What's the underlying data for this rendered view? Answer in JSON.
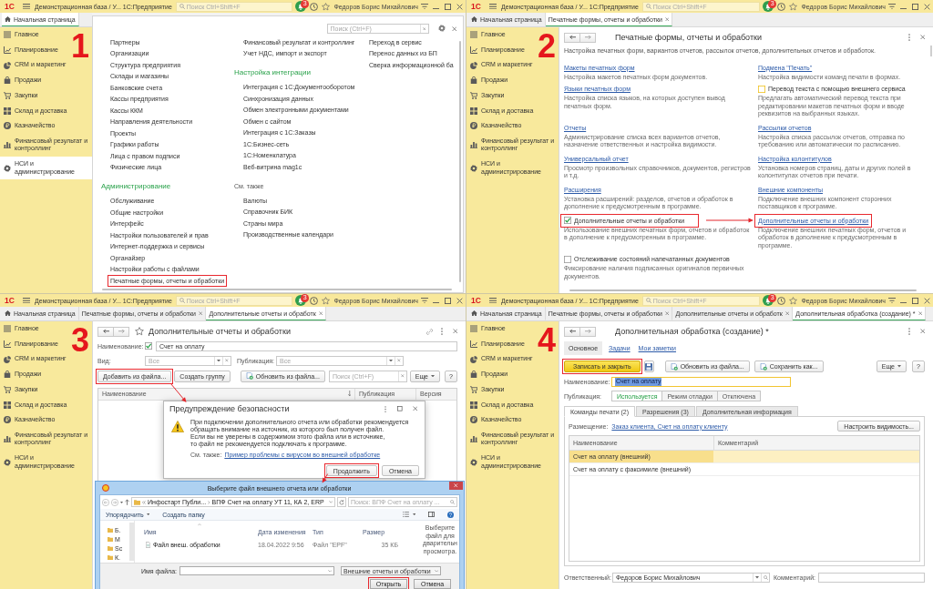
{
  "panels": [
    {
      "kind": "start",
      "step": "1",
      "title_bar": {
        "logo": "1С",
        "title": "Демонстрационная база / У... 1С:Предприятие",
        "search_placeholder": "Поиск Ctrl+Shift+F",
        "badge": "3",
        "user": "Федоров Борис Михайлович"
      },
      "tabs": [
        {
          "kind": "home",
          "label": "Начальная страница",
          "selected": true
        }
      ],
      "sidebar": [
        {
          "label": "Главное",
          "selected": false
        },
        {
          "label": "Планирование",
          "selected": false
        },
        {
          "label": "CRM и маркетинг",
          "selected": false
        },
        {
          "label": "Продажи",
          "selected": false
        },
        {
          "label": "Закупки",
          "selected": false
        },
        {
          "label": "Склад и доставка",
          "selected": false
        },
        {
          "label": "Казначейство",
          "selected": false
        },
        {
          "label": "Финансовый результат и контроллинг",
          "selected": false
        },
        {
          "label": "НСИ и администрирование",
          "selected": true
        }
      ],
      "search": {
        "placeholder": "Поиск (Ctrl+F)"
      },
      "columns": [
        {
          "groups": [
            {
              "items": [
                {
                  "label": "Партнеры"
                },
                {
                  "label": "Организации"
                },
                {
                  "label": "Структура предприятия"
                },
                {
                  "label": "Склады и магазины"
                },
                {
                  "label": "Банковские счета"
                },
                {
                  "label": "Кассы предприятия"
                },
                {
                  "label": "Кассы ККМ"
                },
                {
                  "label": "Направления деятельности"
                },
                {
                  "label": "Проекты"
                },
                {
                  "label": "Графики работы"
                },
                {
                  "label": "Лица с правом подписи"
                },
                {
                  "label": "Физические лица"
                }
              ]
            },
            {
              "heading": {
                "kind": "section",
                "text": "Администрирование"
              },
              "items": [
                {
                  "label": "Обслуживание",
                  "highlighted": false
                },
                {
                  "label": "Общие настройки",
                  "highlighted": false
                },
                {
                  "label": "Интерфейс",
                  "highlighted": false
                },
                {
                  "label": "Настройки пользователей и прав",
                  "highlighted": false
                },
                {
                  "label": "Интернет-поддержка и сервисы",
                  "highlighted": false
                },
                {
                  "label": "Органайзер",
                  "highlighted": false
                },
                {
                  "label": "Настройки работы с файлами",
                  "highlighted": false
                },
                {
                  "label": "Печатные формы, отчеты и обработки",
                  "highlighted": true
                }
              ]
            }
          ]
        },
        {
          "groups": [
            {
              "items": [
                {
                  "label": "Финансовый результат и контроллинг"
                },
                {
                  "label": "Учет НДС, импорт и экспорт"
                }
              ]
            },
            {
              "heading": {
                "kind": "section",
                "text": "Настройка интеграции"
              },
              "items": [
                {
                  "label": "Интеграция с 1С:Документооборотом"
                },
                {
                  "label": "Синхронизация данных"
                },
                {
                  "label": "Обмен электронными документами"
                },
                {
                  "label": "Обмен с сайтом"
                },
                {
                  "label": "Интеграция с 1С:Заказы"
                },
                {
                  "label": "1С:Бизнес-сеть"
                },
                {
                  "label": "1С:Номенклатура"
                },
                {
                  "label": "Веб-витрина mag1c"
                }
              ]
            },
            {
              "heading": {
                "kind": "see_also",
                "text": "См. также"
              },
              "items": [
                {
                  "label": "Валюты"
                },
                {
                  "label": "Справочник БИК"
                },
                {
                  "label": "Страны мира"
                },
                {
                  "label": "Производственные календари"
                }
              ]
            }
          ]
        },
        {
          "groups": [
            {
              "items": [
                {
                  "label": "Переход в сервис"
                },
                {
                  "label": "Перенос данных из БП"
                },
                {
                  "label": "Сверка информационной ба"
                }
              ]
            }
          ]
        }
      ]
    },
    {
      "kind": "print_forms",
      "step": "2",
      "title_bar": {
        "logo": "1С",
        "title": "Демонстрационная база / У... 1С:Предприятие",
        "search_placeholder": "Поиск Ctrl+Shift+F",
        "badge": "3",
        "user": "Федоров Борис Михайлович"
      },
      "tabs": [
        {
          "kind": "home",
          "label": "Начальная страница",
          "selected": false
        },
        {
          "kind": "page",
          "label": "Печатные формы, отчеты и обработки",
          "selected": true
        }
      ],
      "sidebar": [
        {
          "label": "Главное",
          "selected": false
        },
        {
          "label": "Планирование",
          "selected": false
        },
        {
          "label": "CRM и маркетинг",
          "selected": false
        },
        {
          "label": "Продажи",
          "selected": false
        },
        {
          "label": "Закупки",
          "selected": false
        },
        {
          "label": "Склад и доставка",
          "selected": false
        },
        {
          "label": "Казначейство",
          "selected": false
        },
        {
          "label": "Финансовый результат и контроллинг",
          "selected": false
        },
        {
          "label": "НСИ и администрирование",
          "selected": false
        }
      ],
      "title": "Печатные формы, отчеты и обработки",
      "description": "Настройка печатных форм, вариантов отчетов, рассылок отчетов, дополнительных отчетов и обработок.",
      "rows": [
        {
          "left": [
            {
              "kind": "link",
              "label": "Макеты печатных форм",
              "description": "Настройка макетов печатных форм документов.",
              "highlighted": false
            },
            {
              "kind": "link",
              "label": "Языки печатных форм",
              "description": "Настройка списка языков, на которых доступен вывод печатных форм.",
              "highlighted": false
            }
          ],
          "right": [
            {
              "kind": "link",
              "label": "Подмена \"Печать\"",
              "description": "Настройка видимости команд печати в формах.",
              "highlighted": false
            },
            {
              "kind": "checkbox",
              "label": "Перевод текста с помощью внешнего сервиса",
              "checked": false,
              "focused": true,
              "description": "Предлагать автоматический перевод текста при редактировании макетов печатных форм и вводе реквизитов на выбранных языках.",
              "highlighted": false
            }
          ]
        },
        {
          "left": [
            {
              "kind": "link",
              "label": "Отчеты",
              "description": "Администрирование списка всех вариантов отчетов, назначение ответственных и настройка видимости.",
              "highlighted": false
            }
          ],
          "right": [
            {
              "kind": "link",
              "label": "Рассылки отчетов",
              "description": "Настройка списка рассылок отчетов, отправка по требованию или автоматически по расписанию.",
              "highlighted": false
            }
          ]
        },
        {
          "left": [
            {
              "kind": "link",
              "label": "Универсальный отчет",
              "description": "Просмотр произвольных справочников, документов, регистров и т.д.",
              "highlighted": false
            }
          ],
          "right": [
            {
              "kind": "link",
              "label": "Настройка колонтитулов",
              "description": "Установка номеров страниц, даты и других полей в колонтитулах отчетов при печати.",
              "highlighted": false
            }
          ]
        },
        {
          "left": [
            {
              "kind": "link",
              "label": "Расширения",
              "description": "Установка расширений: разделов, отчетов и обработок в дополнение к предусмотренным в программе.",
              "highlighted": false
            }
          ],
          "right": [
            {
              "kind": "link",
              "label": "Внешние компоненты",
              "description": "Подключение внешних компонент сторонних поставщиков к программе.",
              "highlighted": false
            }
          ]
        },
        {
          "left": [
            {
              "kind": "checkbox",
              "label": "Дополнительные отчеты и обработки",
              "checked": true,
              "focused": false,
              "description": "Использование внешних печатных форм, отчетов и обработок в дополнение к предусмотренным в программе.",
              "highlighted": true
            }
          ],
          "right": [
            {
              "kind": "link",
              "label": "Дополнительные отчеты и обработки",
              "description": "Подключение внешних печатных форм, отчетов и обработок в дополнение к предусмотренным в программе.",
              "highlighted": true
            }
          ]
        },
        {
          "left": [
            {
              "kind": "checkbox",
              "label": "Отслеживание состояний напечатанных документов",
              "checked": false,
              "focused": false,
              "description": "Фиксирование наличия подписанных оригиналов первичных документов.",
              "highlighted": false
            }
          ]
        }
      ]
    },
    {
      "kind": "reports_list",
      "step": "3",
      "title_bar": {
        "logo": "1С",
        "title": "Демонстрационная база / У... 1С:Предприятие",
        "search_placeholder": "Поиск Ctrl+Shift+F",
        "badge": "3",
        "user": "Федоров Борис Михайлович"
      },
      "tabs": [
        {
          "kind": "home",
          "label": "Начальная страница",
          "selected": false
        },
        {
          "kind": "page",
          "label": "Печатные формы, отчеты и обработки",
          "selected": false
        },
        {
          "kind": "page",
          "label": "Дополнительные отчеты и обработк",
          "selected": true
        }
      ],
      "sidebar": [
        {
          "label": "Главное",
          "selected": false
        },
        {
          "label": "Планирование",
          "selected": false
        },
        {
          "label": "CRM и маркетинг",
          "selected": false
        },
        {
          "label": "Продажи",
          "selected": false
        },
        {
          "label": "Закупки",
          "selected": false
        },
        {
          "label": "Склад и доставка",
          "selected": false
        },
        {
          "label": "Казначейство",
          "selected": false
        },
        {
          "label": "Финансовый результат и контроллинг",
          "selected": false
        },
        {
          "label": "НСИ и администрирование",
          "selected": false
        }
      ],
      "title": "Дополнительные отчеты и обработки",
      "name_filter": {
        "label": "Наименование:",
        "checked": true,
        "value": "Счет на оплату"
      },
      "kind_filter": {
        "label": "Вид:",
        "placeholder": "Все"
      },
      "publication_filter": {
        "label": "Публикация:",
        "placeholder": "Все"
      },
      "toolbar": [
        {
          "kind": "button",
          "label": "Добавить из файла...",
          "highlighted": true
        },
        {
          "kind": "button",
          "label": "Создать группу",
          "highlighted": false
        },
        {
          "kind": "icon_button",
          "label": "Обновить из файла...",
          "highlighted": false
        }
      ],
      "search": {
        "placeholder": "Поиск (Ctrl+F)"
      },
      "more": "Еще",
      "help": "?",
      "table": {
        "columns": [
          {
            "label": "Наименование",
            "sorted": true
          },
          {
            "label": "Публикация",
            "sorted": false
          },
          {
            "label": "Версия",
            "sorted": false
          }
        ]
      },
      "security_dialog": {
        "title": "Предупреждение безопасности",
        "message": "При подключении дополнительного отчета или обработки рекомендуется\nобращать внимание на источник, из которого был получен файл.\nЕсли вы не уверены в содержимом этого файла или в источнике,\nто файл не рекомендуется подключать к программе.",
        "see_also_label": "См. также:",
        "see_also_link": "Пример проблемы с вирусом во внешней обработке",
        "buttons": [
          {
            "label": "Продолжить",
            "highlighted": true
          },
          {
            "label": "Отмена",
            "highlighted": false
          }
        ]
      },
      "file_dialog": {
        "title": "Выберите файл внешнего отчета или обработки",
        "path": [
          "Инфостарт Публи...",
          "ВПФ Счет на оплату УТ 11, КА 2, ERP"
        ],
        "search_placeholder": "Поиск: ВПФ Счет на оплату ...",
        "toolbar": [
          {
            "kind": "menu",
            "label": "Упорядочить"
          },
          {
            "kind": "button",
            "label": "Создать папку"
          }
        ],
        "nav": [
          "Б.",
          "М",
          "Sc",
          "К."
        ],
        "columns": [
          "Имя",
          "Дата изменения",
          "Тип",
          "Размер"
        ],
        "files": [
          {
            "name": "Файл внеш. обработки",
            "modified": "18.04.2022 9:56",
            "type": "Файл \"EPF\"",
            "size": "35 КБ"
          }
        ],
        "preview_text": "Выберите\nфайл для\nдварительн\nпросмотра.",
        "file_name_label": "Имя файла:",
        "filter": "Внешние отчеты и обработки",
        "buttons": [
          {
            "label": "Открыть",
            "highlighted": true
          },
          {
            "label": "Отмена",
            "highlighted": false
          }
        ]
      }
    },
    {
      "kind": "processing_form",
      "step": "4",
      "title_bar": {
        "logo": "1С",
        "title": "Демонстрационная база / У... 1С:Предприятие",
        "search_placeholder": "Поиск Ctrl+Shift+F",
        "badge": "3",
        "user": "Федоров Борис Михайлович"
      },
      "tabs": [
        {
          "kind": "home",
          "label": "Начальная страница",
          "selected": false
        },
        {
          "kind": "page",
          "label": "Печатные формы, отчеты и обработки",
          "selected": false
        },
        {
          "kind": "page",
          "label": "Дополнительные отчеты и обработк",
          "selected": false
        },
        {
          "kind": "page",
          "label": "Дополнительная обработка (создание) *",
          "selected": true
        }
      ],
      "sidebar": [
        {
          "label": "Главное",
          "selected": false
        },
        {
          "label": "Планирование",
          "selected": false
        },
        {
          "label": "CRM и маркетинг",
          "selected": false
        },
        {
          "label": "Продажи",
          "selected": false
        },
        {
          "label": "Закупки",
          "selected": false
        },
        {
          "label": "Склад и доставка",
          "selected": false
        },
        {
          "label": "Казначейство",
          "selected": false
        },
        {
          "label": "Финансовый результат и контроллинг",
          "selected": false
        },
        {
          "label": "НСИ и администрирование",
          "selected": false
        }
      ],
      "title": "Дополнительная обработка (создание) *",
      "form_tabs": [
        {
          "label": "Основное",
          "selected": true
        },
        {
          "label": "Задачи",
          "selected": false
        },
        {
          "label": "Мои заметки",
          "selected": false
        }
      ],
      "toolbar": [
        {
          "kind": "primary",
          "label": "Записать и закрыть",
          "highlighted": true
        },
        {
          "kind": "icon",
          "highlighted": false
        },
        {
          "kind": "icon_button",
          "label": "Обновить из файла...",
          "highlighted": false
        },
        {
          "kind": "icon_button",
          "label": "Сохранить как...",
          "highlighted": false
        }
      ],
      "more": "Еще",
      "help": "?",
      "name_field": {
        "label": "Наименование:",
        "value": "Счет на оплату",
        "focused": true
      },
      "publication": {
        "label": "Публикация:",
        "options": [
          {
            "label": "Используется",
            "selected": true
          },
          {
            "label": "Режим отладки",
            "selected": false
          },
          {
            "label": "Отключена",
            "selected": false
          }
        ]
      },
      "inner_tabs": [
        {
          "label": "Команды печати (2)",
          "selected": true
        },
        {
          "label": "Разрешения (3)",
          "selected": false
        },
        {
          "label": "Дополнительная информация",
          "selected": false
        }
      ],
      "placement": {
        "label": "Размещение:",
        "link": "Заказ клиента, Счет на оплату клиенту"
      },
      "visibility_button": "Настроить видимость...",
      "table": {
        "columns": [
          "Наименование",
          "Комментарий"
        ],
        "rows": [
          {
            "name": "Счет на оплату (внешний)",
            "selected": true
          },
          {
            "name": "Счет на оплату с факсимиле (внешний)",
            "selected": false
          }
        ]
      },
      "responsible": {
        "label": "Ответственный:",
        "value": "Федоров Борис Михайлович"
      },
      "comment": {
        "label": "Комментарий:"
      }
    }
  ]
}
